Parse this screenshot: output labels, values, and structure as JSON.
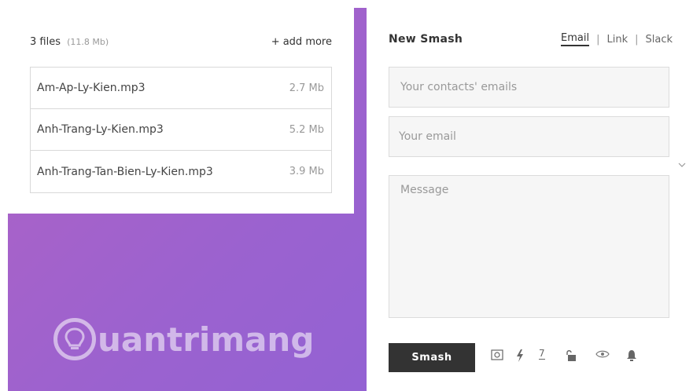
{
  "files": {
    "count_label": "3 files",
    "total_size": "(11.8 Mb)",
    "add_more": "+ add more",
    "items": [
      {
        "name": "Am-Ap-Ly-Kien.mp3",
        "size": "2.7 Mb"
      },
      {
        "name": "Anh-Trang-Ly-Kien.mp3",
        "size": "5.2 Mb"
      },
      {
        "name": "Anh-Trang-Tan-Bien-Ly-Kien.mp3",
        "size": "3.9 Mb"
      }
    ]
  },
  "smash": {
    "title": "New Smash",
    "tabs": [
      "Email",
      "Link",
      "Slack"
    ],
    "active_tab": "Email",
    "contacts_placeholder": "Your contacts' emails",
    "email_placeholder": "Your email",
    "message_placeholder": "Message",
    "send_button": "Smash",
    "options": {
      "days": "7",
      "icons": [
        "image-icon",
        "lightning-icon",
        "unlock-icon",
        "eye-icon",
        "bell-icon"
      ]
    }
  },
  "watermark": {
    "text": "uantrimang",
    "logo_letter": "Q"
  },
  "colors": {
    "background_start": "#b163c4",
    "background_end": "#8a62d8",
    "button": "#333333",
    "input_bg": "#f6f6f6"
  }
}
